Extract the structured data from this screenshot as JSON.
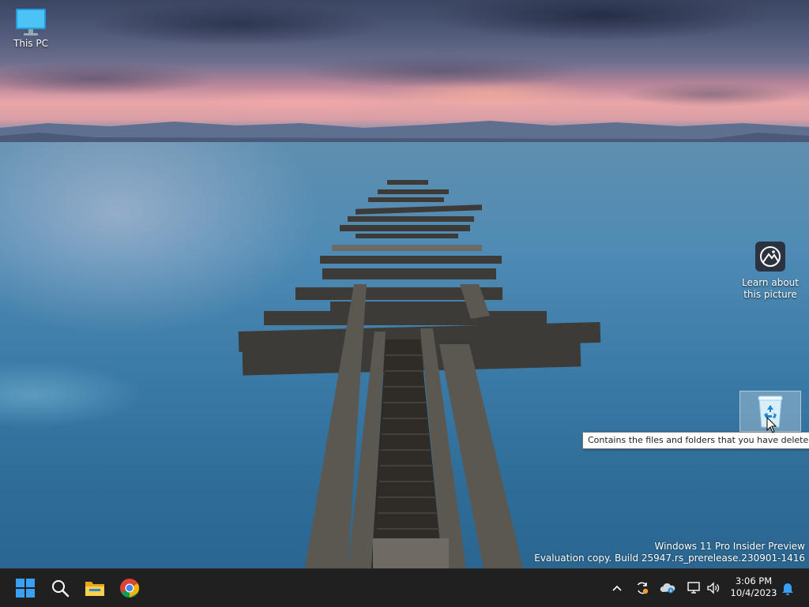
{
  "desktop": {
    "icons": [
      {
        "label": "This PC",
        "icon": "this-pc-icon"
      },
      {
        "label_line1": "Learn about",
        "label_line2": "this picture",
        "icon": "learn-about-picture-icon"
      },
      {
        "label": "",
        "icon": "recycle-bin-icon"
      }
    ],
    "tooltip": "Contains the files and folders that you have deleted.",
    "watermark": {
      "line1": "Windows 11 Pro Insider Preview",
      "line2": "Evaluation copy. Build 25947.rs_prerelease.230901-1416"
    }
  },
  "taskbar": {
    "apps": [
      {
        "name": "Start",
        "icon": "windows-start-icon"
      },
      {
        "name": "Search",
        "icon": "search-icon"
      },
      {
        "name": "File Explorer",
        "icon": "file-explorer-icon"
      },
      {
        "name": "Google Chrome",
        "icon": "chrome-icon"
      }
    ],
    "tray": {
      "icons": [
        "chevron-up-icon",
        "sync-icon",
        "onedrive-icon",
        "network-icon",
        "volume-icon",
        "notification-bell-icon"
      ],
      "time": "3:06 PM",
      "date": "10/4/2023"
    },
    "colors": {
      "background": "#202020",
      "accent": "#3aa0f3"
    }
  }
}
